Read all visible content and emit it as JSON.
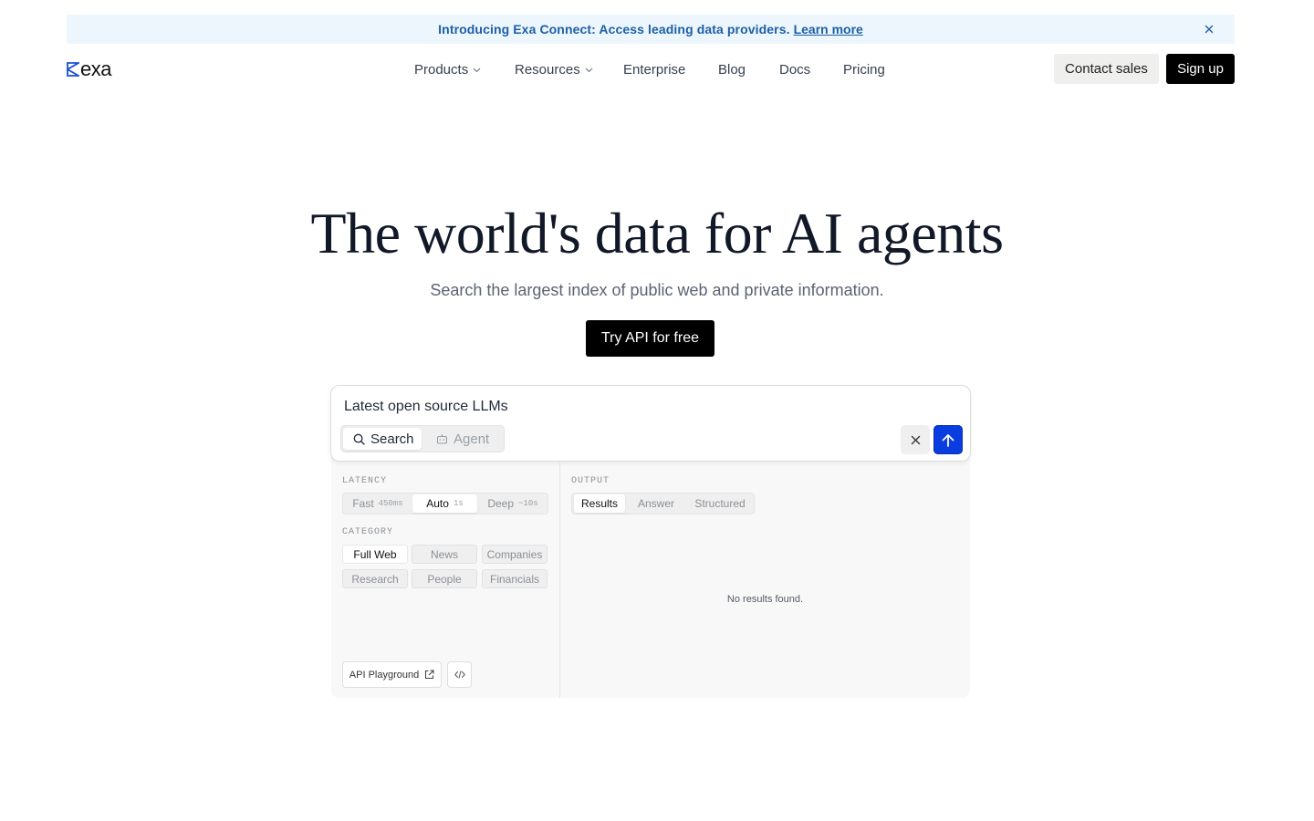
{
  "banner": {
    "text": "Introducing Exa Connect: Access leading data providers.",
    "link_label": "Learn more"
  },
  "nav": {
    "logo_text": "exa",
    "items": [
      {
        "label": "Products",
        "dropdown": true
      },
      {
        "label": "Resources",
        "dropdown": true
      },
      {
        "label": "Enterprise",
        "dropdown": false
      },
      {
        "label": "Blog",
        "dropdown": false
      },
      {
        "label": "Docs",
        "dropdown": false
      },
      {
        "label": "Pricing",
        "dropdown": false
      }
    ],
    "contact_label": "Contact sales",
    "signup_label": "Sign up"
  },
  "hero": {
    "title": "The world's data for AI agents",
    "subtitle": "Search the largest index of public web and private information.",
    "cta_label": "Try API for free"
  },
  "search": {
    "query_value": "Latest open source LLMs",
    "modes": [
      {
        "label": "Search",
        "icon": "search-icon",
        "active": true
      },
      {
        "label": "Agent",
        "icon": "robot-icon",
        "active": false
      }
    ]
  },
  "config": {
    "latency_label": "LATENCY",
    "latency_options": [
      {
        "label": "Fast",
        "hint": "450ms",
        "active": false
      },
      {
        "label": "Auto",
        "hint": "1s",
        "active": true
      },
      {
        "label": "Deep",
        "hint": "~10s",
        "active": false
      }
    ],
    "category_label": "CATEGORY",
    "categories": [
      {
        "label": "Full Web",
        "active": true
      },
      {
        "label": "News",
        "active": false
      },
      {
        "label": "Companies",
        "active": false
      },
      {
        "label": "Research",
        "active": false
      },
      {
        "label": "People",
        "active": false
      },
      {
        "label": "Financials",
        "active": false
      }
    ],
    "playground_label": "API Playground"
  },
  "output": {
    "label": "OUTPUT",
    "tabs": [
      {
        "label": "Results",
        "active": true
      },
      {
        "label": "Answer",
        "active": false
      },
      {
        "label": "Structured",
        "active": false
      }
    ],
    "empty_text": "No results found."
  },
  "colors": {
    "banner_bg": "#ecf6fc",
    "banner_text": "#1d5fa8",
    "accent_blue": "#0a3ddf",
    "primary_button": "#000000"
  }
}
